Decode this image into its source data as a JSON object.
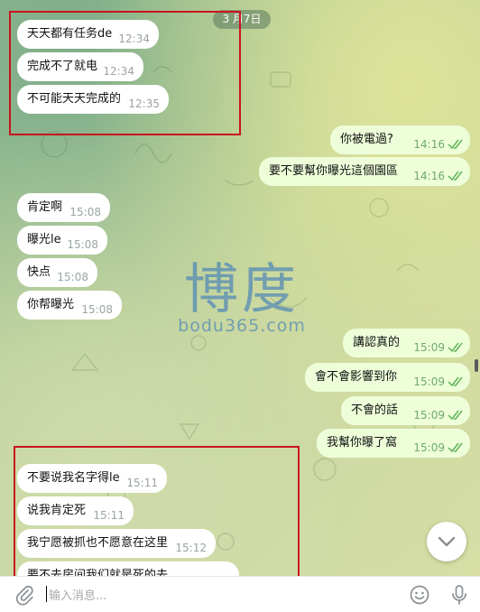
{
  "chat": {
    "date_label": "3 月7日",
    "messages": [
      {
        "dir": "in",
        "text": "天天都有任务de",
        "time": "12:34"
      },
      {
        "dir": "in",
        "text": "完成不了就电",
        "time": "12:34"
      },
      {
        "dir": "in",
        "text": "不可能天天完成的",
        "time": "12:35"
      },
      {
        "dir": "out",
        "text": "你被電過?",
        "time": "14:16"
      },
      {
        "dir": "out",
        "text": "要不要幫你曝光這個園區",
        "time": "14:16"
      },
      {
        "dir": "in",
        "text": "肯定啊",
        "time": "15:08"
      },
      {
        "dir": "in",
        "text": "曝光le",
        "time": "15:08"
      },
      {
        "dir": "in",
        "text": "快点",
        "time": "15:08"
      },
      {
        "dir": "in",
        "text": "你帮曝光",
        "time": "15:08"
      },
      {
        "dir": "out",
        "text": "講認真的",
        "time": "15:09"
      },
      {
        "dir": "out",
        "text": "會不會影響到你",
        "time": "15:09"
      },
      {
        "dir": "out",
        "text": "不會的話",
        "time": "15:09"
      },
      {
        "dir": "out",
        "text": "我幫你曝了窩",
        "time": "15:09"
      },
      {
        "dir": "in",
        "text": "不要说我名字得le",
        "time": "15:11"
      },
      {
        "dir": "in",
        "text": "说我肯定死",
        "time": "15:11"
      },
      {
        "dir": "in",
        "text": "我宁愿被抓也不愿意在这里",
        "time": "15:12"
      },
      {
        "dir": "in",
        "text": "要不去房间我们就是死的去",
        "time": ""
      }
    ]
  },
  "watermark": {
    "logo": "博度",
    "url": "bodu365.com"
  },
  "composer": {
    "placeholder": "输入消息..."
  },
  "colors": {
    "incoming_bubble": "#ffffff",
    "outgoing_bubble": "#eefed9",
    "read_ticks": "#5fb35a",
    "highlight_box": "#c8141e"
  },
  "icons": [
    "attach-icon",
    "emoji-icon",
    "microphone-icon",
    "chevron-down-icon",
    "double-check-icon"
  ]
}
